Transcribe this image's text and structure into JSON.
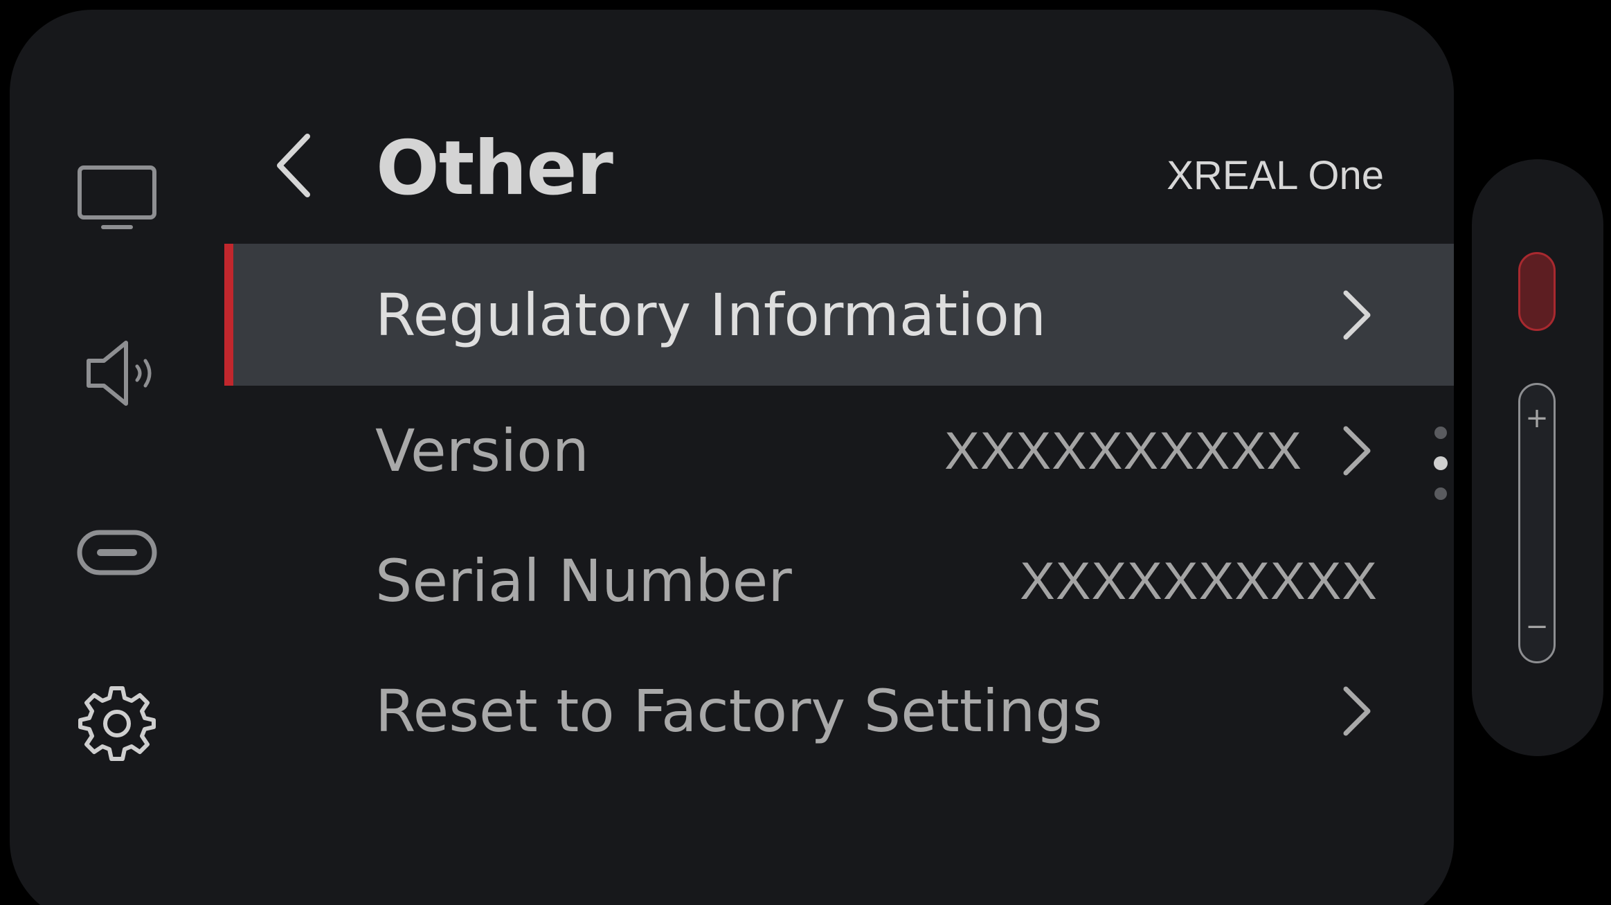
{
  "header": {
    "title": "Other",
    "device_name": "XREAL One"
  },
  "sidebar": {
    "items": [
      {
        "icon": "display-icon"
      },
      {
        "icon": "speaker-icon"
      },
      {
        "icon": "usb-c-port-icon"
      },
      {
        "icon": "gear-icon",
        "selected": true
      }
    ]
  },
  "menu": {
    "items": [
      {
        "label": "Regulatory Information",
        "value": "",
        "has_chevron": true,
        "selected": true
      },
      {
        "label": "Version",
        "value": "XXXXXXXXXX",
        "has_chevron": true
      },
      {
        "label": "Serial Number",
        "value": "XXXXXXXXXX",
        "has_chevron": false
      },
      {
        "label": "Reset to Factory Settings",
        "value": "",
        "has_chevron": true
      }
    ]
  },
  "pagination": {
    "pages": 3,
    "current": 2
  },
  "side_control": {
    "plus_label": "+",
    "minus_label": "−"
  },
  "colors": {
    "accent": "#c1272d",
    "panel_bg": "#17181b",
    "selected_row_bg": "#383b40"
  }
}
